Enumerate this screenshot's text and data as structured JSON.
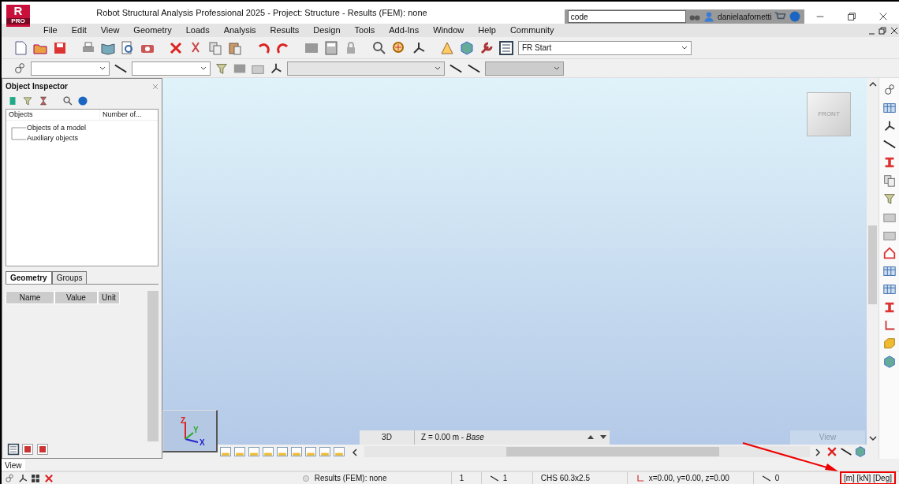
{
  "window": {
    "title": "Robot Structural Analysis Professional 2025 - Project: Structure - Results (FEM): none",
    "logo": "R",
    "logo_badge": "PRO",
    "search": {
      "value": "code"
    },
    "user": "danielaafornetti"
  },
  "menu": [
    "File",
    "Edit",
    "View",
    "Geometry",
    "Loads",
    "Analysis",
    "Results",
    "Design",
    "Tools",
    "Add-Ins",
    "Window",
    "Help",
    "Community"
  ],
  "toolbar": {
    "layout_select": "FR Start"
  },
  "object_inspector": {
    "title": "Object Inspector",
    "columns": [
      "Objects",
      "Number of..."
    ],
    "tree": [
      {
        "label": "Objects of a model"
      },
      {
        "label": "Auxiliary objects"
      }
    ],
    "tabs": [
      {
        "label": "Geometry",
        "selected": true
      },
      {
        "label": "Groups",
        "selected": false
      }
    ],
    "property_columns": [
      "Name",
      "Value",
      "Unit"
    ]
  },
  "viewport": {
    "cube_label": "FRONT",
    "axes": [
      "Z",
      "Y",
      "X"
    ],
    "view_tab": "3D",
    "level": "Z = 0.00 m - *Base*",
    "view_button": "View"
  },
  "prompt": "View",
  "status_bar": {
    "results": "Results (FEM): none",
    "fields": [
      "1",
      "1",
      "CHS 60.3x2.5",
      "x=0.00, y=0.00, z=0.00",
      "0"
    ],
    "units": "[m] [kN] [Deg]"
  }
}
